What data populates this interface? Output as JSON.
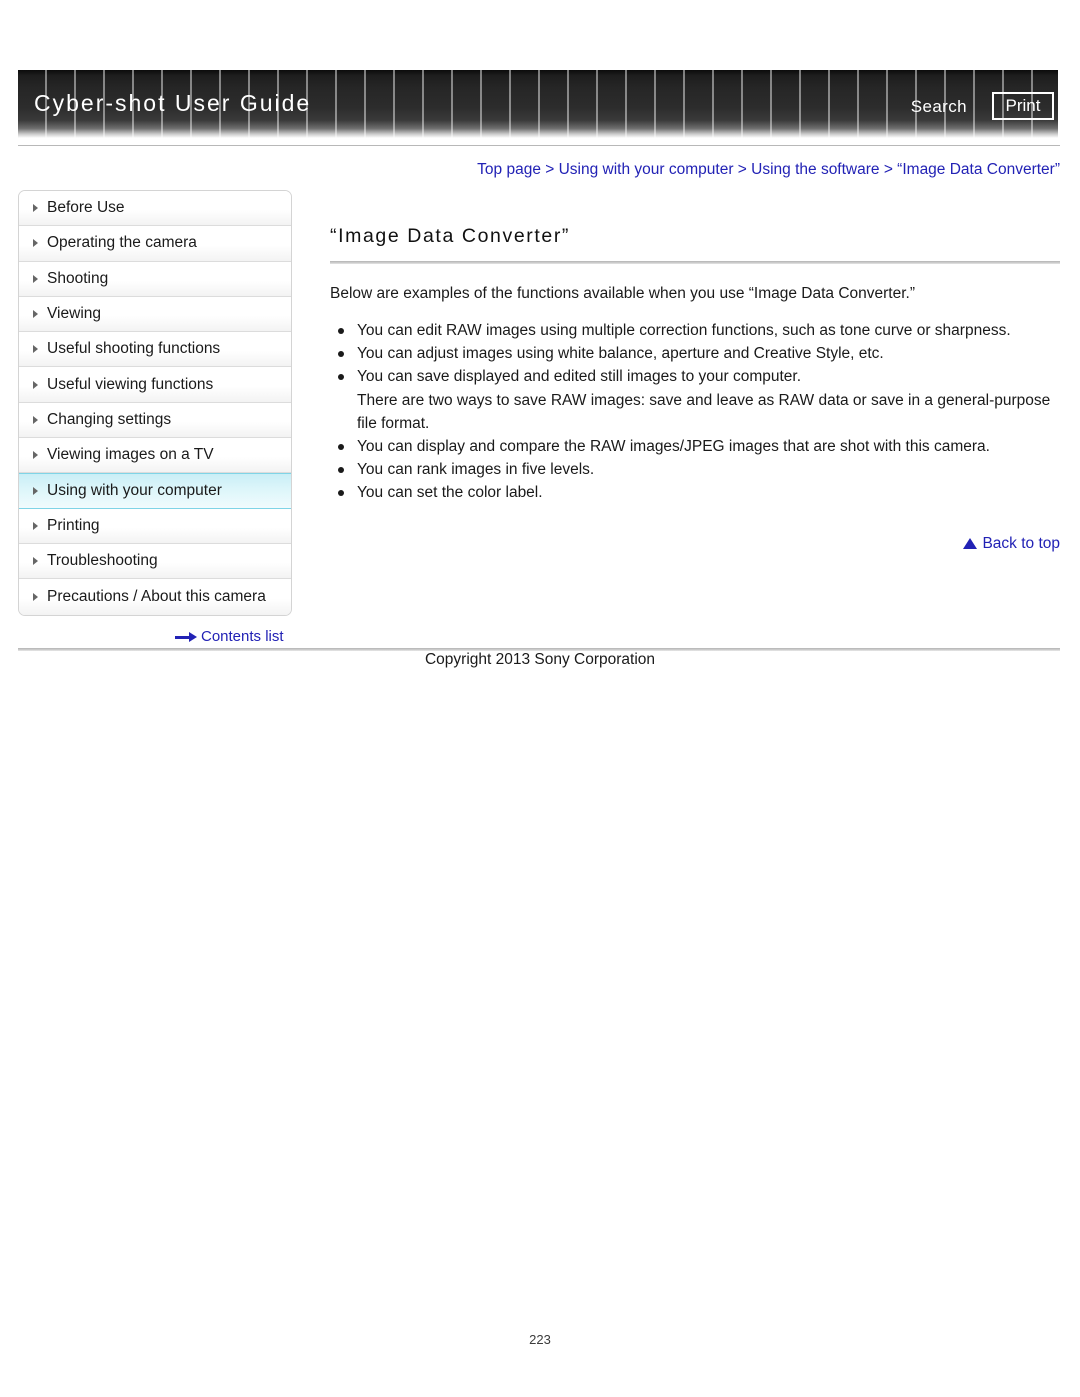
{
  "header": {
    "title": "Cyber-shot User Guide",
    "search_label": "Search",
    "print_label": "Print"
  },
  "breadcrumb": {
    "text": "Top page > Using with your computer > Using the software > “Image Data Converter”"
  },
  "sidebar": {
    "items": [
      {
        "label": "Before Use",
        "active": false
      },
      {
        "label": "Operating the camera",
        "active": false
      },
      {
        "label": "Shooting",
        "active": false
      },
      {
        "label": "Viewing",
        "active": false
      },
      {
        "label": "Useful shooting functions",
        "active": false
      },
      {
        "label": "Useful viewing functions",
        "active": false
      },
      {
        "label": "Changing settings",
        "active": false
      },
      {
        "label": "Viewing images on a TV",
        "active": false
      },
      {
        "label": "Using with your computer",
        "active": true
      },
      {
        "label": "Printing",
        "active": false
      },
      {
        "label": "Troubleshooting",
        "active": false
      },
      {
        "label": "Precautions / About this camera",
        "active": false
      }
    ],
    "contents_list_label": "Contents list"
  },
  "main": {
    "heading": "“Image Data Converter”",
    "intro": "Below are examples of the functions available when you use “Image Data Converter.”",
    "bullets": [
      {
        "text": "You can edit RAW images using multiple correction functions, such as tone curve or sharpness.",
        "sub": ""
      },
      {
        "text": "You can adjust images using white balance, aperture and Creative Style, etc.",
        "sub": ""
      },
      {
        "text": "You can save displayed and edited still images to your computer.",
        "sub": "There are two ways to save RAW images: save and leave as RAW data or save in a general-purpose file format."
      },
      {
        "text": "You can display and compare the RAW images/JPEG images that are shot with this camera.",
        "sub": ""
      },
      {
        "text": "You can rank images in five levels.",
        "sub": ""
      },
      {
        "text": "You can set the color label.",
        "sub": ""
      }
    ],
    "back_to_top_label": "Back to top"
  },
  "footer": {
    "copyright": "Copyright 2013 Sony Corporation",
    "page_number": "223"
  }
}
